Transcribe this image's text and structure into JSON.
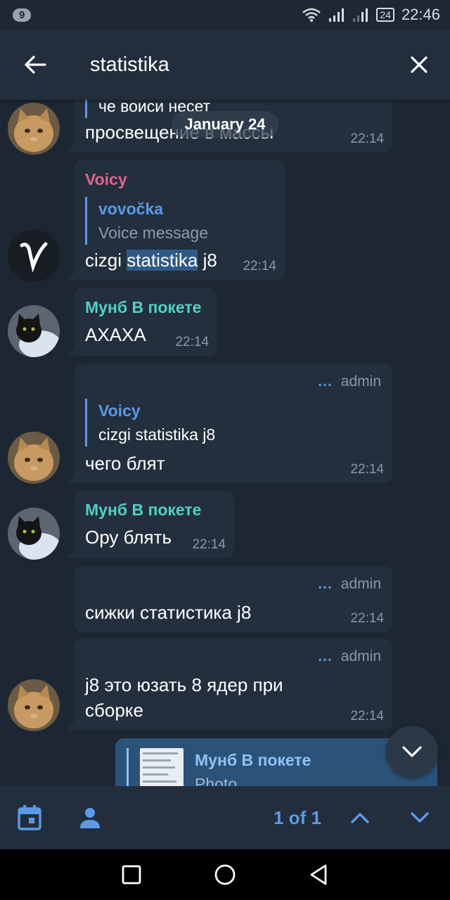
{
  "status_bar": {
    "notification_count": "9",
    "battery": "24",
    "time": "22:46"
  },
  "header": {
    "search_query": "statistika"
  },
  "date_chip": "January 24",
  "messages": [
    {
      "quote_fragment": "че воиси несет",
      "text": "просвещение в массы",
      "time": "22:14"
    },
    {
      "sender": "Voicy",
      "reply_name": "vovočka",
      "reply_text": "Voice message",
      "text_before": "cizgi ",
      "text_highlight": "statistika",
      "text_after": " j8",
      "time": "22:14"
    },
    {
      "sender": "Мунб В покете",
      "text": "АХАХА",
      "time": "22:14"
    },
    {
      "badge": "admin",
      "reply_name": "Voicy",
      "reply_text": "cizgi statistika j8",
      "text": "чего блят",
      "time": "22:14"
    },
    {
      "sender": "Мунб В покете",
      "text": "Ору блять",
      "time": "22:14"
    },
    {
      "badge": "admin",
      "text": "сижки статистика j8",
      "time": "22:14"
    },
    {
      "badge": "admin",
      "text_line1": "j8 это юзать 8 ядер при",
      "text_line2": "сборке",
      "time": "22:14"
    },
    {
      "reply_name": "Мунб В покете",
      "reply_text": "Photo"
    }
  ],
  "bottom_bar": {
    "counter": "1 of 1"
  },
  "colors": {
    "accent": "#5a9be6",
    "voicy_name": "#e5638a",
    "munb_name": "#4fd1c5",
    "bubble": "#232f3d",
    "background": "#1d2733"
  }
}
